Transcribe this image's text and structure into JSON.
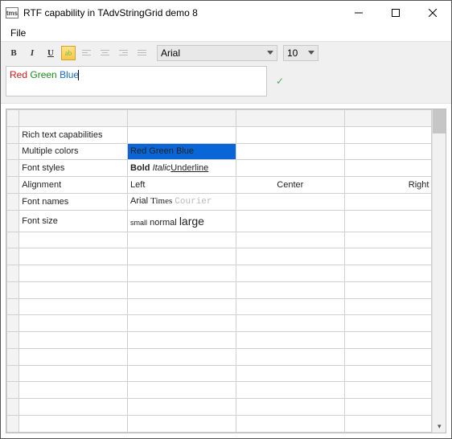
{
  "window": {
    "icon_label": "tms",
    "title": "RTF capability in TAdvStringGrid demo 8"
  },
  "menubar": {
    "file": "File"
  },
  "toolbar": {
    "bold": "B",
    "italic": "I",
    "underline": "U",
    "highlight": "ab",
    "font_name": "Arial",
    "font_size": "10"
  },
  "editor": {
    "word_red": "Red",
    "word_green": "Green",
    "word_blue": "Blue"
  },
  "grid": {
    "rows": [
      {
        "c1": "Rich text capabilities",
        "c2": "",
        "c3": "",
        "c4": ""
      },
      {
        "c1": "Multiple colors",
        "c2_r": "Red",
        "c2_g": "Green",
        "c2_b": "Blue",
        "c3": "",
        "c4": ""
      },
      {
        "c1": "Font styles",
        "c2_bold": "Bold",
        "c2_italic": "Italic",
        "c2_uline": "Underline",
        "c3": "",
        "c4": ""
      },
      {
        "c1": "Alignment",
        "c2": "Left",
        "c3": "Center",
        "c4": "Right"
      },
      {
        "c1": "Font names",
        "c2_arial": "Arial",
        "c2_times": "Times",
        "c2_courier": "Courier",
        "c3": "",
        "c4": ""
      },
      {
        "c1": "Font size",
        "c2_small": "small",
        "c2_normal": "normal",
        "c2_large": "large",
        "c3": "",
        "c4": ""
      }
    ]
  }
}
